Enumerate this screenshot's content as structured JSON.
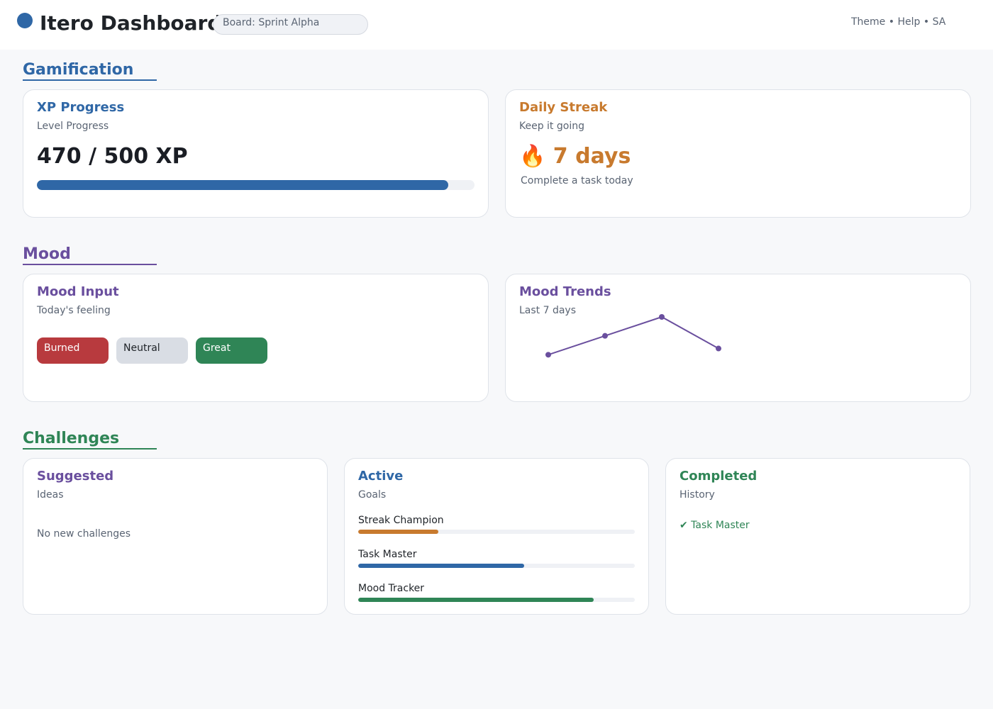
{
  "header": {
    "title": "Itero Dashboard",
    "board_select": "Board: Sprint Alpha",
    "links": [
      "Theme",
      "Help",
      "SA"
    ],
    "separator": "•"
  },
  "sections": {
    "gamification": "Gamification",
    "mood": "Mood",
    "challenges": "Challenges"
  },
  "xp": {
    "title": "XP Progress",
    "subtitle": "Level Progress",
    "value": "470 / 500 XP",
    "progress": 0.94
  },
  "streak": {
    "title": "Daily Streak",
    "subtitle": "Keep it going",
    "value": "🔥 7 days",
    "hint": "Complete a task today"
  },
  "mood_input": {
    "title": "Mood Input",
    "subtitle": "Today's feeling",
    "options": [
      "Burned",
      "Neutral",
      "Great"
    ]
  },
  "mood_trends": {
    "title": "Mood Trends",
    "subtitle": "Last 7 days",
    "chart_data": {
      "type": "line",
      "series": [
        {
          "values": [
            1,
            2,
            3,
            1.33
          ]
        }
      ],
      "ylim": [
        0,
        3
      ],
      "grid": false
    }
  },
  "challenges": {
    "suggested": {
      "title": "Suggested",
      "subtitle": "Ideas",
      "empty": "No new challenges"
    },
    "active": {
      "title": "Active",
      "subtitle": "Goals",
      "goals": [
        {
          "name": "Streak Champion",
          "progress": 0.29,
          "color": "#c87a2e"
        },
        {
          "name": "Task Master",
          "progress": 0.6,
          "color": "#2f67a6"
        },
        {
          "name": "Mood Tracker",
          "progress": 0.85,
          "color": "#2f8556"
        }
      ]
    },
    "completed": {
      "title": "Completed",
      "subtitle": "History",
      "items": [
        "✔ Task Master"
      ]
    }
  },
  "colors": {
    "blue": "#2f67a6",
    "orange": "#c87a2e",
    "purple": "#6a4f9e",
    "green": "#2f8556",
    "red": "#b83a3e"
  }
}
